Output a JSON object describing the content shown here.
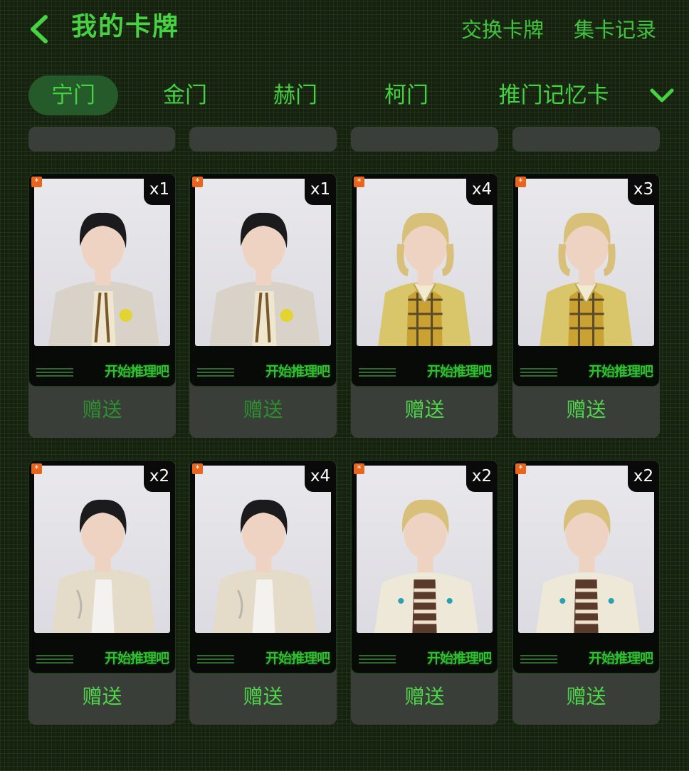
{
  "header": {
    "title": "我的卡牌",
    "exchange_label": "交换卡牌",
    "records_label": "集卡记录"
  },
  "tabs": [
    {
      "label": "宁门",
      "active": true
    },
    {
      "label": "金门",
      "active": false
    },
    {
      "label": "赫门",
      "active": false
    },
    {
      "label": "柯门",
      "active": false
    },
    {
      "label": "推门记忆卡",
      "active": false
    }
  ],
  "gift_label": "赠送",
  "card_logo": "开始推理吧",
  "corner_mark": "*",
  "cards": [
    {
      "count": "x1",
      "gift_enabled": false,
      "person": "dark-hair-man-blazer-lemon"
    },
    {
      "count": "x1",
      "gift_enabled": false,
      "person": "dark-hair-man-blazer-lemon"
    },
    {
      "count": "x4",
      "gift_enabled": true,
      "person": "blonde-woman-plaid-vest"
    },
    {
      "count": "x3",
      "gift_enabled": true,
      "person": "blonde-woman-plaid-vest-wink"
    },
    {
      "count": "x2",
      "gift_enabled": true,
      "person": "dark-hair-man-beige-jacket"
    },
    {
      "count": "x4",
      "gift_enabled": true,
      "person": "dark-hair-man-beige-jacket"
    },
    {
      "count": "x2",
      "gift_enabled": true,
      "person": "blonde-man-cream-jacket-striped-shirt"
    },
    {
      "count": "x2",
      "gift_enabled": true,
      "person": "blonde-man-cream-jacket-striped-shirt"
    }
  ],
  "colors": {
    "background": "#16210f",
    "accent": "#47d341",
    "active_tab": "#255a2b",
    "tile": "#3a3e39",
    "badge": "#0a0a0a"
  },
  "icons": {
    "back": "chevron-left-icon",
    "more_tabs": "chevron-down-icon"
  }
}
